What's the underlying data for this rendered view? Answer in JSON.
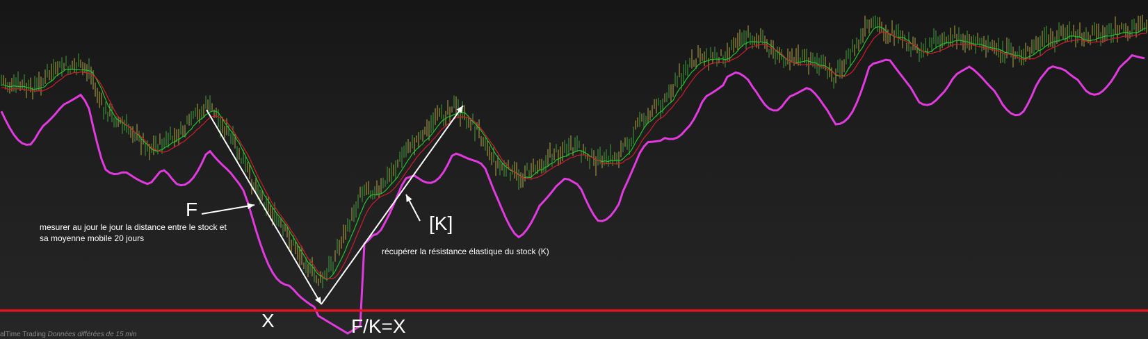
{
  "chart_data": {
    "type": "line",
    "title": "",
    "xlabel": "",
    "ylabel": "",
    "grid": false,
    "series": [
      {
        "role": "price",
        "color": "#b8a840"
      },
      {
        "role": "ma-green",
        "color": "#22c52a"
      },
      {
        "role": "ma-red",
        "color": "#d21c2c"
      },
      {
        "role": "elastic-resistance",
        "color": "#e13be0"
      }
    ],
    "baseline_color": "#e5121c",
    "arrow_color": "#ffffff"
  },
  "annotations": {
    "f_label": "F",
    "f_note_line1": "mesurer au jour le jour la distance entre le stock et",
    "f_note_line2": "sa moyenne mobile 20 jours",
    "k_label": "[K]",
    "k_note": "récupérer la résistance élastique du stock (K)",
    "x_label": "X",
    "fkx_label": "F/K=X"
  },
  "footer": {
    "source": "alTime Trading",
    "delay": "Données différées de 15 min"
  }
}
